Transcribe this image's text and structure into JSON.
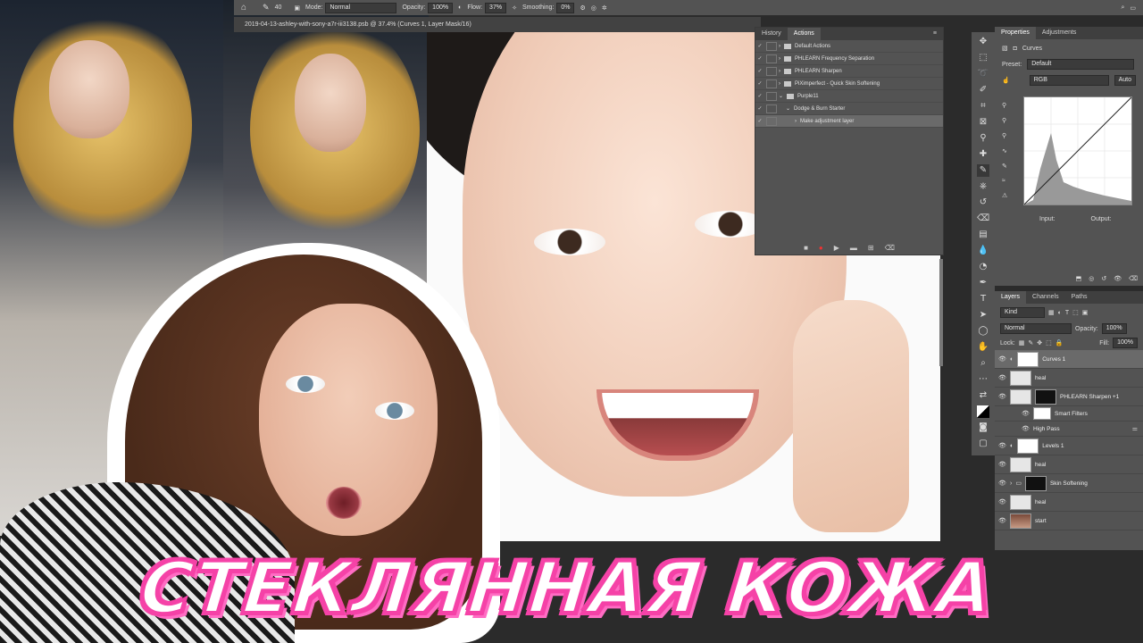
{
  "headline": "СТЕКЛЯННАЯ КОЖА",
  "options_bar": {
    "brush_size": "40",
    "mode_label": "Mode:",
    "mode_value": "Normal",
    "opacity_label": "Opacity:",
    "opacity_value": "100%",
    "flow_label": "Flow:",
    "flow_value": "37%",
    "smoothing_label": "Smoothing:",
    "smoothing_value": "0%"
  },
  "document": {
    "tab_title": "2019-04-13-ashley-with-sony-a7r-iii3138.psb @ 37.4% (Curves 1, Layer Mask/16)"
  },
  "actions_panel": {
    "tabs": [
      "History",
      "Actions"
    ],
    "active_tab": "Actions",
    "items": [
      {
        "label": "Default Actions",
        "level": 0
      },
      {
        "label": "PHLEARN Frequency Separation",
        "level": 0
      },
      {
        "label": "PHLEARN Sharpen",
        "level": 0
      },
      {
        "label": "PiXimperfect - Quick Skin Softening",
        "level": 0
      },
      {
        "label": "Purple11",
        "level": 0
      },
      {
        "label": "Dodge & Burn Starter",
        "level": 1
      },
      {
        "label": "Make adjustment layer",
        "level": 2
      }
    ]
  },
  "properties_panel": {
    "tabs": [
      "Properties",
      "Adjustments"
    ],
    "adjustment_name": "Curves",
    "preset_label": "Preset:",
    "preset_value": "Default",
    "channel_value": "RGB",
    "auto_label": "Auto",
    "input_label": "Input:",
    "output_label": "Output:"
  },
  "layers_panel": {
    "tabs": [
      "Layers",
      "Channels",
      "Paths"
    ],
    "filter_value": "Kind",
    "blend_mode": "Normal",
    "opacity_label": "Opacity:",
    "opacity_value": "100%",
    "lock_label": "Lock:",
    "fill_label": "Fill:",
    "fill_value": "100%",
    "layers": [
      {
        "name": "Curves 1",
        "selected": true
      },
      {
        "name": "heal"
      },
      {
        "name": "PHLEARN Sharpen +1"
      },
      {
        "name": "Smart Filters"
      },
      {
        "name": "High Pass"
      },
      {
        "name": "Levels 1"
      },
      {
        "name": "heal"
      },
      {
        "name": "Skin Softening"
      },
      {
        "name": "heal"
      },
      {
        "name": "start"
      }
    ]
  },
  "colors": {
    "headline_stroke": "#f542a7",
    "ps_panel": "#535353",
    "ps_dark": "#2b2b2b"
  }
}
